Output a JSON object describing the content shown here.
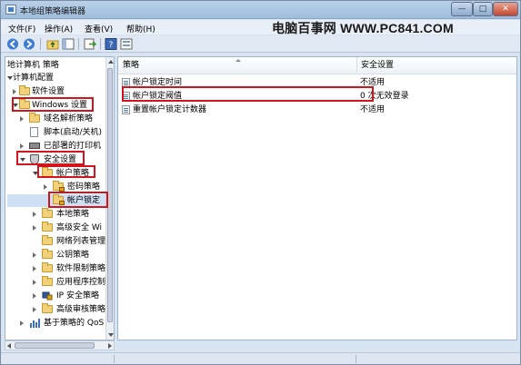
{
  "window": {
    "title": "本地组策略编辑器",
    "controls": {
      "minimize": "—",
      "maximize": "□",
      "close": "✕"
    }
  },
  "menubar": {
    "items": [
      "文件(F)",
      "操作(A)",
      "查看(V)",
      "帮助(H)"
    ]
  },
  "watermark": "电脑百事网 WWW.PC841.COM",
  "toolbar": {
    "icons": [
      "back-icon",
      "forward-icon",
      "up-folder-icon",
      "show-hide-tree-icon",
      "export-list-icon",
      "help-icon",
      "properties-icon"
    ]
  },
  "tree": {
    "items": [
      {
        "label": "地计算机 策略",
        "depth": 0
      },
      {
        "label": "计算机配置",
        "depth": 0
      },
      {
        "label": "软件设置",
        "depth": 1
      },
      {
        "label": "Windows 设置",
        "depth": 1
      },
      {
        "label": "域名解析策略",
        "depth": 2
      },
      {
        "label": "脚本(启动/关机)",
        "depth": 2
      },
      {
        "label": "已部署的打印机",
        "depth": 2
      },
      {
        "label": "安全设置",
        "depth": 2
      },
      {
        "label": "帐户策略",
        "depth": 3
      },
      {
        "label": "密码策略",
        "depth": 4
      },
      {
        "label": "帐户锁定",
        "depth": 4
      },
      {
        "label": "本地策略",
        "depth": 3
      },
      {
        "label": "高级安全 Wi",
        "depth": 3
      },
      {
        "label": "网络列表管理",
        "depth": 3
      },
      {
        "label": "公钥策略",
        "depth": 3
      },
      {
        "label": "软件限制策略",
        "depth": 3
      },
      {
        "label": "应用程序控制",
        "depth": 3
      },
      {
        "label": "IP 安全策略",
        "depth": 3
      },
      {
        "label": "高级审核策略",
        "depth": 3
      },
      {
        "label": "基于策略的 QoS",
        "depth": 2
      }
    ]
  },
  "list": {
    "columns": [
      "策略",
      "安全设置"
    ],
    "rows": [
      {
        "policy": "帐户锁定时间",
        "setting": "不适用"
      },
      {
        "policy": "帐户锁定阈值",
        "setting": "0 次无效登录"
      },
      {
        "policy": "重置帐户锁定计数器",
        "setting": "不适用"
      }
    ]
  },
  "colors": {
    "highlight_border": "#d4141c",
    "window_bg": "#d7e4f2"
  }
}
